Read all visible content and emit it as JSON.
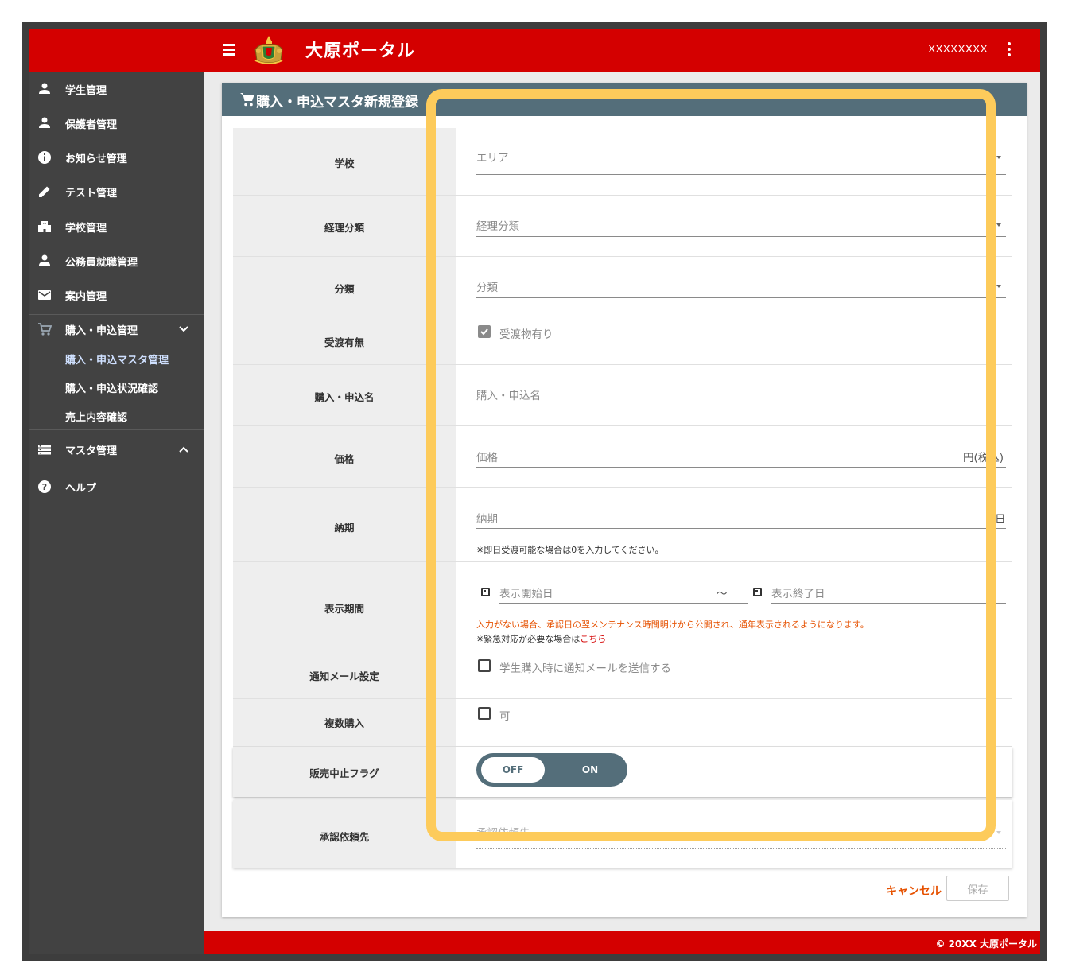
{
  "header": {
    "app_title": "大原ポータル",
    "user_name": "XXXXXXXX",
    "brand_color": "#d40000"
  },
  "sidebar": {
    "items": [
      {
        "label": "学生管理",
        "icon": "person-icon"
      },
      {
        "label": "保護者管理",
        "icon": "person-icon"
      },
      {
        "label": "お知らせ管理",
        "icon": "info-icon"
      },
      {
        "label": "テスト管理",
        "icon": "pencil-icon"
      },
      {
        "label": "学校管理",
        "icon": "building-icon"
      },
      {
        "label": "公務員就職管理",
        "icon": "person-icon"
      },
      {
        "label": "案内管理",
        "icon": "mail-icon"
      },
      {
        "label": "購入・申込管理",
        "icon": "cart-icon",
        "expanded": true,
        "children": [
          "購入・申込マスタ管理",
          "購入・申込状況確認",
          "売上内容確認"
        ]
      },
      {
        "label": "マスタ管理",
        "icon": "list-icon",
        "expanded": false
      },
      {
        "label": "ヘルプ",
        "icon": "help-icon"
      }
    ],
    "active_child": "購入・申込マスタ管理"
  },
  "page": {
    "title": "購入・申込マスタ新規登録",
    "accent_color": "#546e7a"
  },
  "form": {
    "school": {
      "label": "学校",
      "placeholder": "エリア"
    },
    "accounting": {
      "label": "経理分類",
      "placeholder": "経理分類"
    },
    "category": {
      "label": "分類",
      "placeholder": "分類"
    },
    "delivery": {
      "label": "受渡有無",
      "option": "受渡物有り",
      "checked": true
    },
    "name": {
      "label": "購入・申込名",
      "placeholder": "購入・申込名"
    },
    "price": {
      "label": "価格",
      "placeholder": "価格",
      "suffix": "円(税込)"
    },
    "due": {
      "label": "納期",
      "placeholder": "納期",
      "suffix": "日",
      "note": "※即日受渡可能な場合は0を入力してください。"
    },
    "period": {
      "label": "表示期間",
      "start_placeholder": "表示開始日",
      "separator": "～",
      "end_placeholder": "表示終了日",
      "warning": "入力がない場合、承認日の翌メンテナンス時間明けから公開され、通年表示されるようになります。",
      "note_prefix": "※緊急対応が必要な場合は",
      "note_link": "こちら"
    },
    "notify": {
      "label": "通知メール設定",
      "option": "学生購入時に通知メールを送信する",
      "checked": false
    },
    "multiple": {
      "label": "複数購入",
      "option": "可",
      "checked": false
    },
    "stop_flag": {
      "label": "販売中止フラグ",
      "off_label": "OFF",
      "on_label": "ON",
      "value": "OFF"
    },
    "approver": {
      "label": "承認依頼先",
      "placeholder": "承認依頼先"
    }
  },
  "actions": {
    "cancel_label": "キャンセル",
    "save_label": "保存"
  },
  "footer": {
    "copyright": "© 20XX 大原ポータル"
  },
  "highlight_color": "#fdcb5b"
}
